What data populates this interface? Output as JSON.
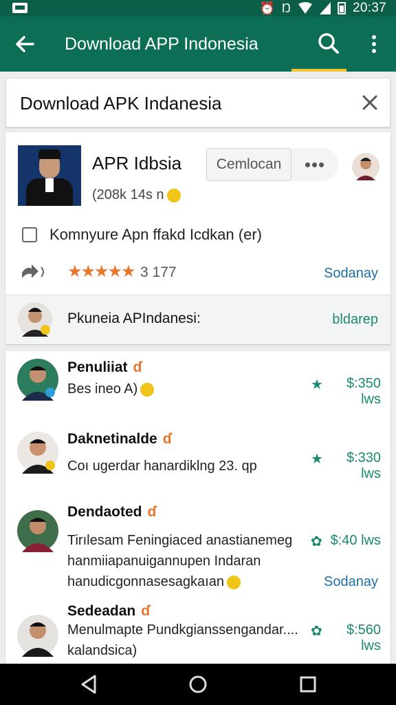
{
  "status_bar": {
    "time": "20:37",
    "icons": [
      "notification-icon",
      "alarm-icon",
      "nfc-icon",
      "wifi-icon",
      "signal-icon",
      "battery-icon"
    ]
  },
  "app_bar": {
    "title": "Download APP Indonesia",
    "icons": [
      "back-arrow-icon",
      "search-icon",
      "more-vert-icon"
    ]
  },
  "search": {
    "query": "Download APK Indanesia"
  },
  "app_card": {
    "name": "APR Idbsia",
    "meta": "(208k 14s n",
    "install_label": "Cemlocan",
    "overflow_label": "•••",
    "checkbox_label": "Komnyure Apn ffakd Icdkan (er)",
    "stars": "★★★★★",
    "rating_count": "3 177",
    "see_link": "Sodanay",
    "publisher_name": "Pkuneia APIndanesi:",
    "publisher_link": "bldarep"
  },
  "reviews": [
    {
      "author": "Penuliiat",
      "text_lines": [
        "Bes ineo A)"
      ],
      "price": "$:350 lws",
      "link": ""
    },
    {
      "author": "Daknetinalde",
      "text_lines": [
        "Coı ugerdar hanardiklng 23. qp"
      ],
      "price": "$:330 lws",
      "link": ""
    },
    {
      "author": "Dendaoted",
      "text_lines": [
        "Tirılesam Feningiaced anastianemeg",
        "hanmiiapanuigannupen Indaran",
        "hanudicgonnasesagkaıan"
      ],
      "price": "$:40 lws",
      "link": "Sodanay"
    },
    {
      "author": "Sedeadan",
      "text_lines": [
        "Menulmapte Pundkgianssengandar....",
        "kalandsica)"
      ],
      "price": "$:560 lws",
      "link": ""
    }
  ],
  "colors": {
    "app_bar": "#0b6e55",
    "status_bar": "#0b5e48",
    "accent": "#f2c330",
    "star": "#e8752a",
    "link_blue": "#1f6fa8",
    "link_green": "#1a8a6e"
  }
}
